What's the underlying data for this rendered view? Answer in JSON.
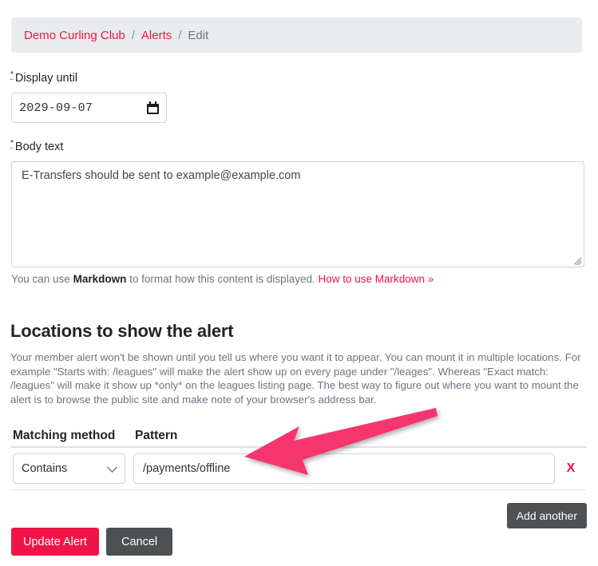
{
  "breadcrumb": {
    "items": [
      {
        "label": "Demo Curling Club",
        "current": false
      },
      {
        "label": "Alerts",
        "current": false
      },
      {
        "label": "Edit",
        "current": true
      }
    ],
    "separator": "/"
  },
  "form": {
    "display_until": {
      "label": "Display until",
      "required_marker": "*",
      "value": "2029-09-07",
      "icon": "calendar-icon"
    },
    "body_text": {
      "label": "Body text",
      "required_marker": "*",
      "value": "E-Transfers should be sent to example@example.com"
    },
    "markdown_help": {
      "prefix": "You can use ",
      "bold": "Markdown",
      "middle": " to format how this content is displayed. ",
      "link": "How to use Markdown »"
    }
  },
  "locations": {
    "title": "Locations to show the alert",
    "description": "Your member alert won't be shown until you tell us where you want it to appear. You can mount it in multiple locations. For example \"Starts with: /leagues\" will make the alert show up on every page under \"/leages\". Whereas \"Exact match: /leagues\" will make it show up *only* on the leagues listing page. The best way to figure out where you want to mount the alert is to browse the public site and make note of your browser's address bar.",
    "columns": {
      "method": "Matching method",
      "pattern": "Pattern"
    },
    "rows": [
      {
        "method": "Contains",
        "pattern": "/payments/offline",
        "remove_label": "X"
      }
    ],
    "add_another_label": "Add another"
  },
  "actions": {
    "submit_label": "Update Alert",
    "cancel_label": "Cancel"
  },
  "annotation": {
    "type": "arrow",
    "color": "#f5366e",
    "points_to": "pattern-input"
  },
  "colors": {
    "accent": "#f01446",
    "dark_button": "#4d5154",
    "breadcrumb_bg": "#e9ecef",
    "muted_text": "#6c757d",
    "border": "#ced4da",
    "annotation_pink": "#f5366e"
  }
}
